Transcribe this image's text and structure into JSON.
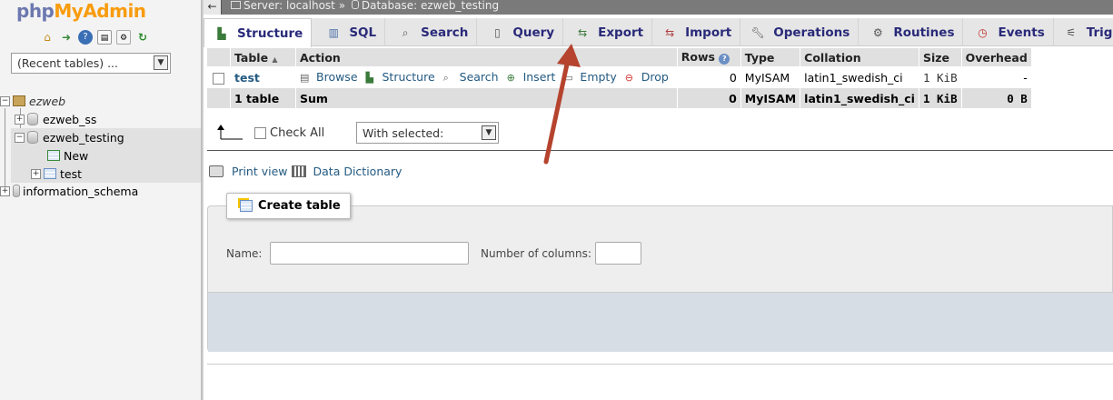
{
  "nav": {
    "logo_php": "php",
    "logo_myadmin": "MyAdmin",
    "recent_tables": "(Recent tables) ...",
    "tree": [
      {
        "label": "ezweb"
      },
      {
        "label": "ezweb_ss"
      },
      {
        "label": "ezweb_testing"
      },
      {
        "label": "New"
      },
      {
        "label": "test"
      },
      {
        "label": "information_schema"
      }
    ]
  },
  "topbar": {
    "server": "Server: localhost",
    "sep": "»",
    "database": "Database: ezweb_testing"
  },
  "tabs": [
    {
      "label": "Structure",
      "icon": "structure-icon"
    },
    {
      "label": "SQL",
      "icon": "sql-icon"
    },
    {
      "label": "Search",
      "icon": "search-icon"
    },
    {
      "label": "Query",
      "icon": "query-icon"
    },
    {
      "label": "Export",
      "icon": "export-icon"
    },
    {
      "label": "Import",
      "icon": "import-icon"
    },
    {
      "label": "Operations",
      "icon": "wrench-icon"
    },
    {
      "label": "Routines",
      "icon": "routines-icon"
    },
    {
      "label": "Events",
      "icon": "clock-icon"
    },
    {
      "label": "Triggers",
      "icon": "triggers-icon"
    }
  ],
  "table": {
    "headers": {
      "table": "Table",
      "action": "Action",
      "rows": "Rows",
      "type": "Type",
      "collation": "Collation",
      "size": "Size",
      "overhead": "Overhead"
    },
    "row": {
      "name": "test",
      "browse": "Browse",
      "structure": "Structure",
      "search": "Search",
      "insert": "Insert",
      "empty": "Empty",
      "drop": "Drop",
      "rows": "0",
      "type": "MyISAM",
      "collation": "latin1_swedish_ci",
      "size": "1 KiB",
      "overhead": "-"
    },
    "sum": {
      "name": "1 table",
      "label": "Sum",
      "rows": "0",
      "type": "MyISAM",
      "collation": "latin1_swedish_ci",
      "size": "1 KiB",
      "overhead": "0 B"
    }
  },
  "bulk": {
    "check_all": "Check All",
    "with_selected": "With selected:"
  },
  "links": {
    "print_view": "Print view",
    "data_dictionary": "Data Dictionary"
  },
  "create": {
    "legend": "Create table",
    "name_label": "Name:",
    "columns_label": "Number of columns:",
    "name_value": "",
    "columns_value": ""
  },
  "colors": {
    "link": "#235a81",
    "annotation_arrow": "#b5432e"
  }
}
